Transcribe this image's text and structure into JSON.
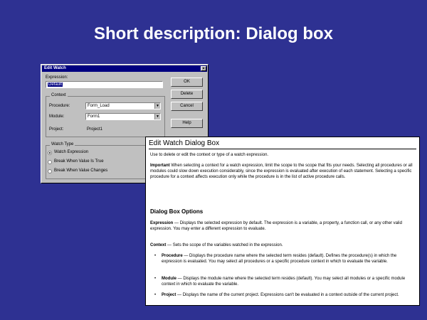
{
  "slide": {
    "title": "Short description: Dialog box"
  },
  "dialog": {
    "title": "Edit Watch",
    "close_glyph": "×",
    "expression_label": "Expression:",
    "expression_value": "Default",
    "context_group": "Context",
    "procedure_label": "Procedure:",
    "procedure_value": "Form_Load",
    "module_label": "Module:",
    "module_value": "Form1",
    "project_label": "Project:",
    "project_value": "Project1",
    "watch_type_group": "Watch Type",
    "radios": [
      {
        "label": "Watch Expression",
        "selected": true
      },
      {
        "label": "Break When Value Is True",
        "selected": false
      },
      {
        "label": "Break When Value Changes",
        "selected": false
      }
    ],
    "buttons": {
      "ok": "OK",
      "delete": "Delete",
      "cancel": "Cancel",
      "help": "Help"
    },
    "dropdown_glyph": "▼"
  },
  "help": {
    "title": "Edit Watch Dialog Box",
    "intro": "Use to delete or edit the context or type of a watch expression.",
    "intro_link": "watch expression",
    "important_label": "Important",
    "important_text": "When selecting a context for a watch expression, limit the scope to the scope that fits your needs. Selecting all procedures or all modules could slow down execution considerably, since the expression is evaluated after execution of each statement. Selecting a specific procedure for a context affects execution only while the procedure is in the list of active procedure calls.",
    "options_heading": "Dialog Box Options",
    "expression_label": "Expression",
    "expression_text": "Displays the selected expression by default. The expression is a variable, a property, a function call, or any other valid expression. You may enter a different expression to evaluate.",
    "context_label": "Context",
    "context_text": "Sets the scope of the variables watched in the expression.",
    "bullets": [
      {
        "label": "Procedure",
        "text": "Displays the procedure name where the selected term resides (default). Defines the procedure(s) in which the expression is evaluated. You may select all procedures or a specific procedure context in which to evaluate the variable."
      },
      {
        "label": "Module",
        "text": "Displays the module name where the selected term resides (default). You may select all modules or a specific module context in which to evaluate the variable."
      },
      {
        "label": "Project",
        "text": "Displays the name of the current project. Expressions can't be evaluated in a context outside of the current project."
      }
    ],
    "bullet_glyph": "•",
    "dash": " — "
  }
}
